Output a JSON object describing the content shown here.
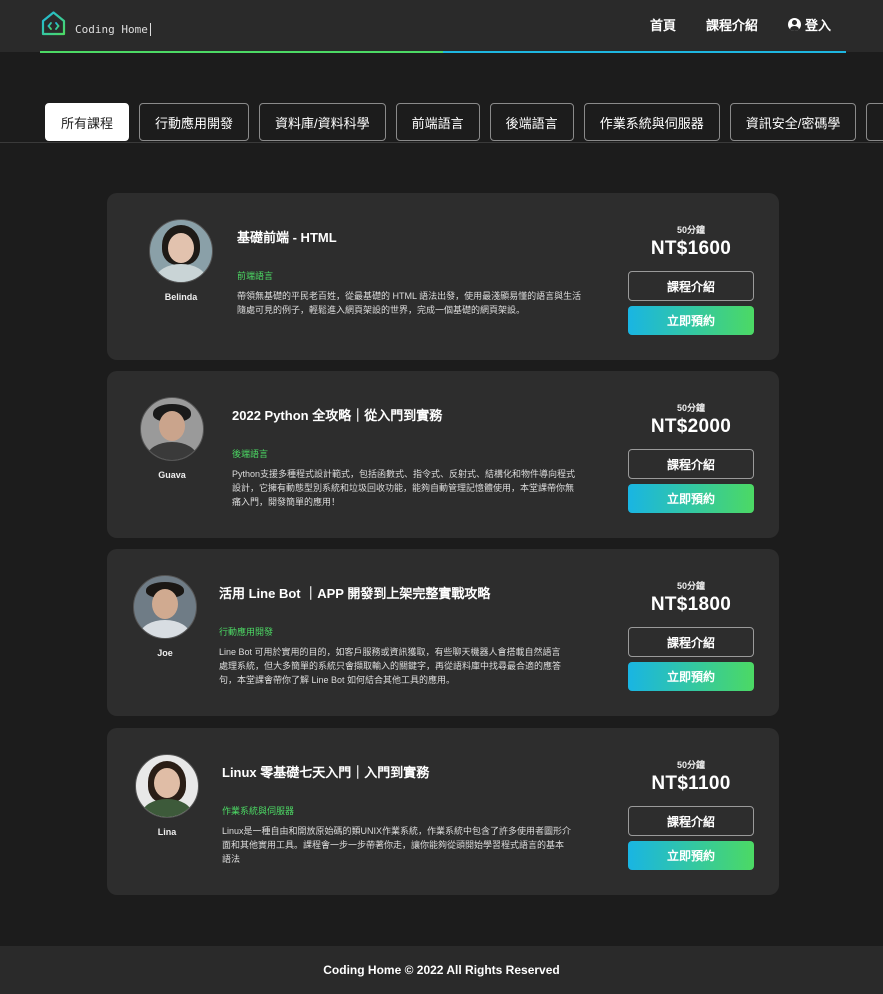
{
  "header": {
    "logo_text": "Coding Home",
    "nav": {
      "home": "首頁",
      "courses": "課程介紹",
      "login": "登入"
    }
  },
  "tabs": [
    "所有課程",
    "行動應用開發",
    "資料庫/資料科學",
    "前端語言",
    "後端語言",
    "作業系統與伺服器",
    "資訊安全/密碼學"
  ],
  "courses": [
    {
      "teacher": "Belinda",
      "title": "基礎前端 - HTML",
      "category": "前端語言",
      "description": "帶領無基礎的平民老百姓，從最基礎的 HTML 語法出發，使用最淺顯易懂的語言與生活隨處可見的例子，輕鬆進入網頁架設的世界，完成一個基礎的網頁架設。",
      "duration": "50分鐘",
      "price": "NT$1600",
      "intro_btn": "課程介紹",
      "book_btn": "立即預約"
    },
    {
      "teacher": "Guava",
      "title": "2022 Python 全攻略｜從入門到實務",
      "category": "後端語言",
      "description": "Python支援多種程式設計範式，包括函數式、指令式、反射式、結構化和物件導向程式設計，它擁有動態型別系統和垃圾回收功能，能夠自動管理記憶體使用，本堂課帶你無痛入門，開發簡單的應用！",
      "duration": "50分鐘",
      "price": "NT$2000",
      "intro_btn": "課程介紹",
      "book_btn": "立即預約"
    },
    {
      "teacher": "Joe",
      "title": "活用 Line Bot ｜APP 開發到上架完整實戰攻略",
      "category": "行動應用開發",
      "description": "Line Bot 可用於實用的目的，如客戶服務或資訊獲取，有些聊天機器人會搭載自然語言處理系統，但大多簡單的系統只會擷取輸入的關鍵字，再從語料庫中找尋最合適的應答句，本堂課會帶你了解 Line Bot 如何結合其他工具的應用。",
      "duration": "50分鐘",
      "price": "NT$1800",
      "intro_btn": "課程介紹",
      "book_btn": "立即預約"
    },
    {
      "teacher": "Lina",
      "title": "Linux 零基礎七天入門｜入門到實務",
      "category": "作業系統與伺服器",
      "description": "Linux是一種自由和開放原始碼的類UNIX作業系統，作業系統中包含了許多使用者圖形介面和其他實用工具。課程會一步一步帶著你走，讓你能夠從頭開始學習程式語言的基本語法",
      "duration": "50分鐘",
      "price": "NT$1100",
      "intro_btn": "課程介紹",
      "book_btn": "立即預約"
    }
  ],
  "footer": {
    "text": "Coding Home © 2022 All Rights Reserved"
  }
}
